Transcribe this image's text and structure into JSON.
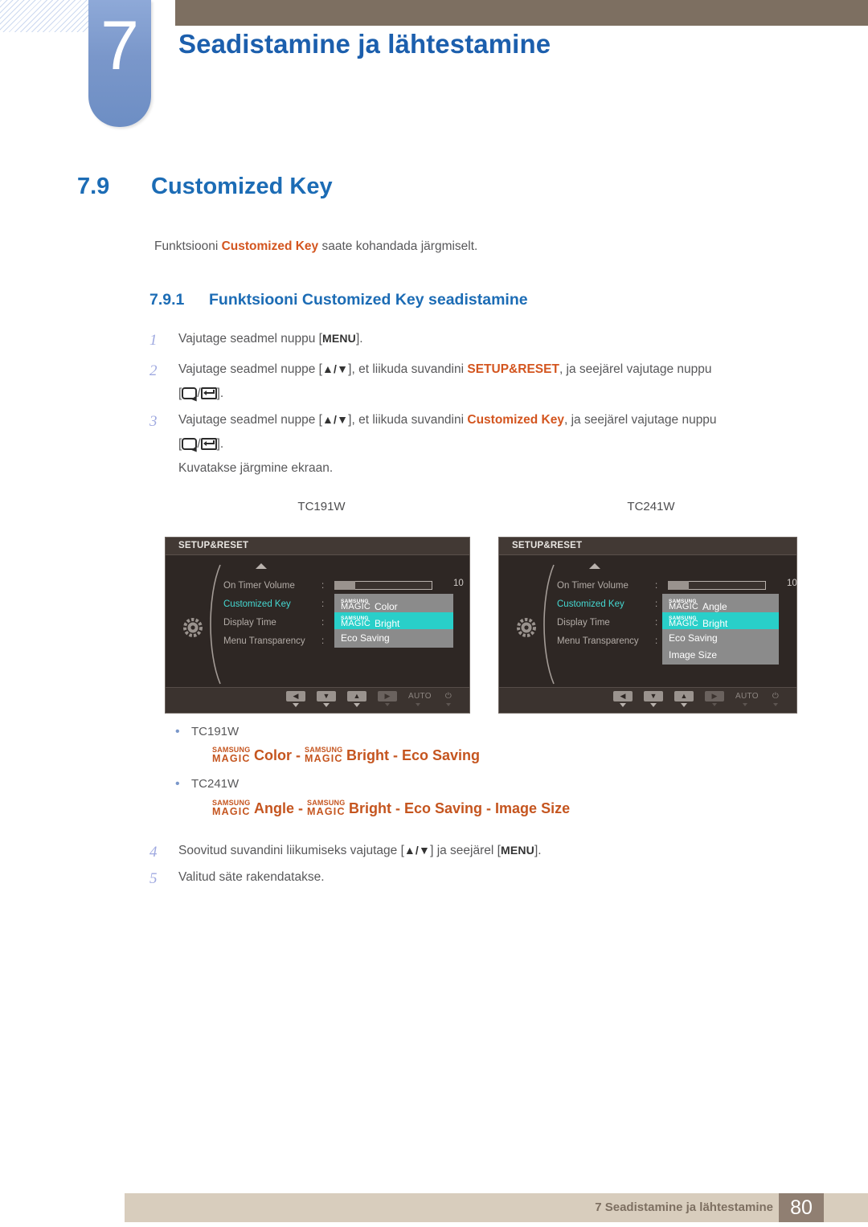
{
  "header": {
    "chapter_number": "7",
    "chapter_title": "Seadistamine ja lähtestamine"
  },
  "section": {
    "number": "7.9",
    "title": "Customized Key",
    "intro_before": "Funktsiooni ",
    "intro_highlight": "Customized Key",
    "intro_after": " saate kohandada järgmiselt."
  },
  "subsection": {
    "number": "7.9.1",
    "title": "Funktsiooni Customized Key seadistamine"
  },
  "steps": [
    {
      "index": "1",
      "a": "Vajutage seadmel nuppu [",
      "key": "MENU",
      "b": "]."
    },
    {
      "index": "2",
      "a": "Vajutage seadmel nuppe [",
      "arrows": "▲/▼",
      "b": "], et liikuda suvandini ",
      "highlight": "SETUP&RESET",
      "c": ", ja seejärel vajutage nuppu",
      "bracket_open": "[",
      "bracket_slash": "/",
      "bracket_close": "]."
    },
    {
      "index": "3",
      "a": "Vajutage seadmel nuppe [",
      "arrows": "▲/▼",
      "b": "], et liikuda suvandini ",
      "highlight": "Customized Key",
      "c": ", ja seejärel vajutage nuppu",
      "bracket_open": "[",
      "bracket_slash": "/",
      "bracket_close": "].",
      "note": "Kuvatakse järgmine ekraan."
    },
    {
      "index": "4",
      "a": "Soovitud suvandini liikumiseks vajutage [",
      "arrows": "▲/▼",
      "b": "] ja seejärel [",
      "key": "MENU",
      "c": "]."
    },
    {
      "index": "5",
      "a": "Valitud säte rakendatakse."
    }
  ],
  "figures": [
    {
      "label": "TC191W",
      "osd_title": "SETUP&RESET",
      "rows": [
        {
          "label": "On Timer  Volume",
          "colon": ":",
          "type": "slider",
          "value": "10",
          "fill_pct": 21
        },
        {
          "label": "Customized Key",
          "colon": ":",
          "selected": true
        },
        {
          "label": "Display Time",
          "colon": ":"
        },
        {
          "label": "Menu Transparency",
          "colon": ":"
        }
      ],
      "dropdown": [
        {
          "magic_top": "SAMSUNG",
          "magic_bottom": "MAGIC",
          "text": "Color",
          "active": false
        },
        {
          "magic_top": "SAMSUNG",
          "magic_bottom": "MAGIC",
          "text": "Bright",
          "active": true
        },
        {
          "text": "Eco Saving",
          "active": false
        }
      ],
      "buttons": [
        {
          "name": "left",
          "glyph": "◀"
        },
        {
          "name": "down",
          "glyph": "▼"
        },
        {
          "name": "up",
          "glyph": "▲"
        },
        {
          "name": "right",
          "glyph": "▶",
          "dim": true
        },
        {
          "name": "auto",
          "glyph": "AUTO",
          "text": true,
          "dim": true
        },
        {
          "name": "power",
          "glyph": "⏻",
          "power": true,
          "dim": true
        }
      ]
    },
    {
      "label": "TC241W",
      "osd_title": "SETUP&RESET",
      "rows": [
        {
          "label": "On Timer  Volume",
          "colon": ":",
          "type": "slider",
          "value": "10",
          "fill_pct": 21
        },
        {
          "label": "Customized Key",
          "colon": ":",
          "selected": true
        },
        {
          "label": "Display Time",
          "colon": ":"
        },
        {
          "label": "Menu Transparency",
          "colon": ":"
        }
      ],
      "dropdown": [
        {
          "magic_top": "SAMSUNG",
          "magic_bottom": "MAGIC",
          "text": "Angle",
          "active": false
        },
        {
          "magic_top": "SAMSUNG",
          "magic_bottom": "MAGIC",
          "text": "Bright",
          "active": true
        },
        {
          "text": "Eco Saving",
          "active": false
        },
        {
          "text": "Image Size",
          "active": false
        }
      ],
      "buttons": [
        {
          "name": "left",
          "glyph": "◀"
        },
        {
          "name": "down",
          "glyph": "▼"
        },
        {
          "name": "up",
          "glyph": "▲"
        },
        {
          "name": "right",
          "glyph": "▶",
          "dim": true
        },
        {
          "name": "auto",
          "glyph": "AUTO",
          "text": true,
          "dim": true
        },
        {
          "name": "power",
          "glyph": "⏻",
          "power": true,
          "dim": true
        }
      ]
    }
  ],
  "bullets": [
    {
      "model": "TC191W",
      "magic_top": "SAMSUNG",
      "magic_bottom": "MAGIC",
      "first": "Color",
      "sep1": " - ",
      "magic_top2": "SAMSUNG",
      "magic_bottom2": "MAGIC",
      "second": "Bright",
      "rest": " - Eco Saving"
    },
    {
      "model": "TC241W",
      "magic_top": "SAMSUNG",
      "magic_bottom": "MAGIC",
      "first": "Angle",
      "sep1": " - ",
      "magic_top2": "SAMSUNG",
      "magic_bottom2": "MAGIC",
      "second": "Bright",
      "rest": " - Eco Saving - Image Size"
    }
  ],
  "footer": {
    "text": "7 Seadistamine ja lähtestamine",
    "page": "80"
  },
  "colors": {
    "accent_blue": "#1c6cb5",
    "highlight_orange": "#d3551f",
    "header_brown": "#7d6f61",
    "tab_blue": "#7a97ca",
    "footer_beige": "#d8cdbd",
    "osd_bg": "#2e2724",
    "osd_active": "#29cfc9"
  }
}
